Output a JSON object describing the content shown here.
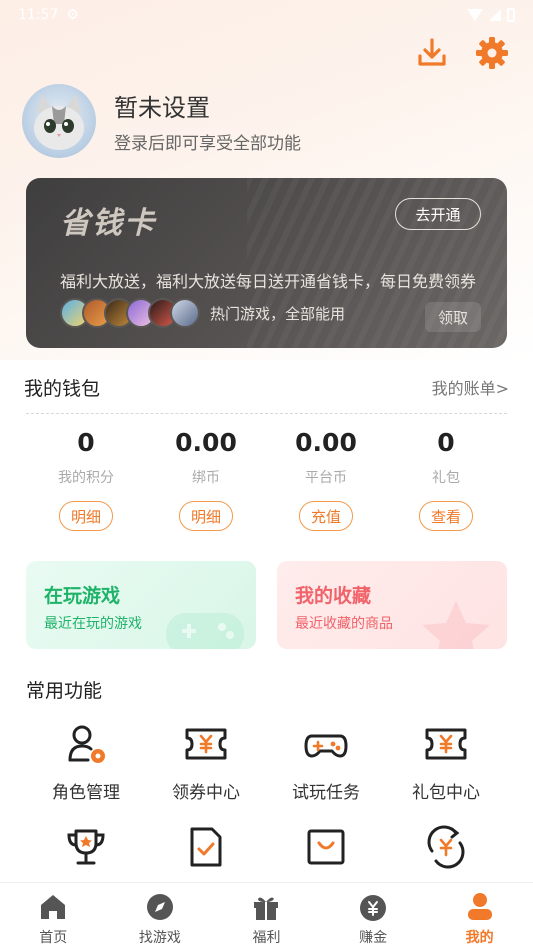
{
  "status_bar": {
    "time": "11:57"
  },
  "profile": {
    "name": "暂未设置",
    "subtitle": "登录后即可享受全部功能"
  },
  "savings_card": {
    "title": "省钱卡",
    "open_button": "去开通",
    "marquee": "福利大放送，福利大放送每日送开通省钱卡，每日免费领券",
    "hot_games_text": "热门游戏，全部能用",
    "claim_button": "领取"
  },
  "wallet": {
    "title": "我的钱包",
    "bill_link": "我的账单>",
    "items": [
      {
        "value": "0",
        "label": "我的积分",
        "button": "明细"
      },
      {
        "value": "0.00",
        "label": "绑币",
        "button": "明细"
      },
      {
        "value": "0.00",
        "label": "平台币",
        "button": "充值"
      },
      {
        "value": "0",
        "label": "礼包",
        "button": "查看"
      }
    ]
  },
  "tiles": {
    "playing": {
      "title": "在玩游戏",
      "subtitle": "最近在玩的游戏"
    },
    "favorites": {
      "title": "我的收藏",
      "subtitle": "最近收藏的商品"
    }
  },
  "common_functions": {
    "title": "常用功能",
    "items": [
      {
        "label": "角色管理",
        "icon": "role-manage-icon"
      },
      {
        "label": "领券中心",
        "icon": "coupon-icon"
      },
      {
        "label": "试玩任务",
        "icon": "gamepad-icon"
      },
      {
        "label": "礼包中心",
        "icon": "gift-ticket-icon"
      },
      {
        "label": "",
        "icon": "trophy-icon"
      },
      {
        "label": "",
        "icon": "task-doc-icon"
      },
      {
        "label": "",
        "icon": "shop-bag-icon"
      },
      {
        "label": "",
        "icon": "exchange-icon"
      }
    ]
  },
  "tabbar": {
    "items": [
      {
        "label": "首页",
        "icon": "home-icon"
      },
      {
        "label": "找游戏",
        "icon": "compass-icon"
      },
      {
        "label": "福利",
        "icon": "gift-icon"
      },
      {
        "label": "赚金",
        "icon": "money-bag-icon"
      },
      {
        "label": "我的",
        "icon": "user-icon"
      }
    ],
    "active_index": 4
  },
  "colors": {
    "accent": "#f07a2a",
    "green": "#1fb36a",
    "pink": "#f0636a",
    "card_bg": "#4a4847"
  }
}
